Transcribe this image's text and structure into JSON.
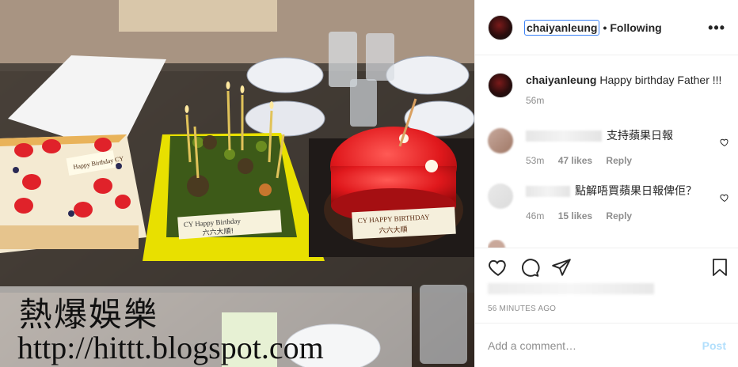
{
  "post": {
    "username": "chaiyanleung",
    "follow_status": "Following",
    "separator": "•",
    "more_icon": "more-horizontal-icon"
  },
  "caption": {
    "username": "chaiyanleung",
    "text": "Happy birthday Father !!!",
    "age": "56m"
  },
  "comments": [
    {
      "text": "支持蘋果日報",
      "age": "53m",
      "likes": "47 likes",
      "reply": "Reply"
    },
    {
      "text": "點解唔買蘋果日報俾佢？",
      "age": "46m",
      "likes": "15 likes",
      "reply": "Reply"
    }
  ],
  "timestamp": "56 MINUTES AGO",
  "add_comment": {
    "placeholder": "Add a comment…",
    "post_label": "Post"
  },
  "photo": {
    "cake1_text": "Happy Birthday CY",
    "cake2_text_1": "CY Happy Birthday",
    "cake2_text_2": "六六大順!",
    "cake3_text_1": "CY HAPPY BIRTHDAY",
    "cake3_text_2": "六六大順"
  },
  "watermark": {
    "line1": "熱爆娛樂",
    "line2": "http://hittt.blogspot.com"
  },
  "colors": {
    "link_blue": "#b2dffc",
    "meta_gray": "#8e8e8e",
    "text": "#262626"
  }
}
